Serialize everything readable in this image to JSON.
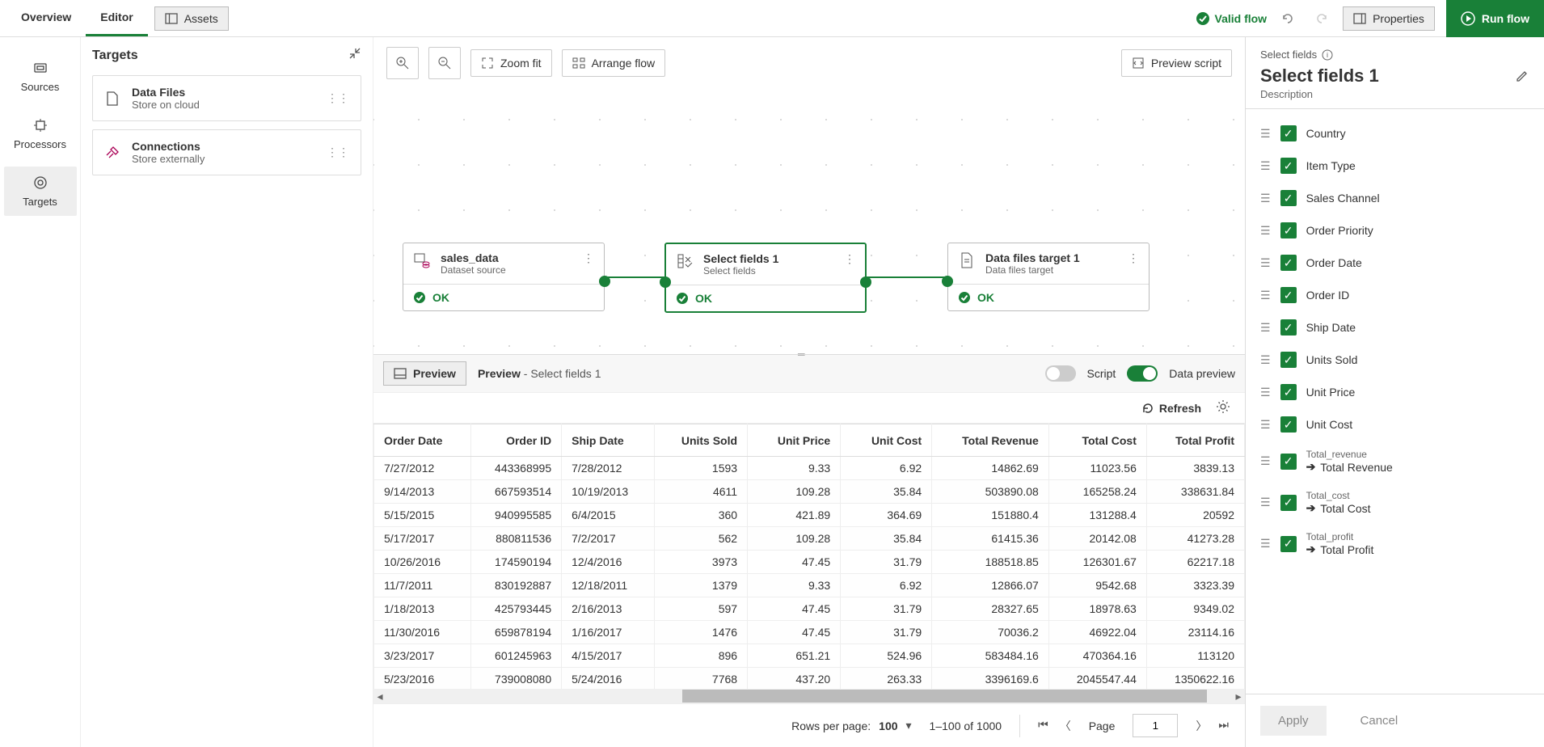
{
  "topbar": {
    "tabs": [
      "Overview",
      "Editor"
    ],
    "active_tab": "Editor",
    "assets_label": "Assets",
    "valid_flow": "Valid flow",
    "properties": "Properties",
    "run_flow": "Run flow"
  },
  "left_rail": {
    "items": [
      {
        "id": "sources",
        "label": "Sources"
      },
      {
        "id": "processors",
        "label": "Processors"
      },
      {
        "id": "targets",
        "label": "Targets"
      }
    ],
    "active": "targets"
  },
  "side_panel": {
    "title": "Targets",
    "cards": [
      {
        "title": "Data Files",
        "sub": "Store on cloud"
      },
      {
        "title": "Connections",
        "sub": "Store externally"
      }
    ]
  },
  "canvas": {
    "zoom_fit": "Zoom fit",
    "arrange_flow": "Arrange flow",
    "preview_script": "Preview script",
    "nodes": [
      {
        "title": "sales_data",
        "sub": "Dataset source",
        "status": "OK"
      },
      {
        "title": "Select fields 1",
        "sub": "Select fields",
        "status": "OK"
      },
      {
        "title": "Data files target 1",
        "sub": "Data files target",
        "status": "OK"
      }
    ]
  },
  "preview": {
    "btn": "Preview",
    "title": "Preview",
    "suffix": " - Select fields 1",
    "script": "Script",
    "data_preview": "Data preview",
    "refresh": "Refresh"
  },
  "table": {
    "columns": [
      "Order Date",
      "Order ID",
      "Ship Date",
      "Units Sold",
      "Unit Price",
      "Unit Cost",
      "Total Revenue",
      "Total Cost",
      "Total Profit"
    ],
    "rows": [
      [
        "7/27/2012",
        "443368995",
        "7/28/2012",
        "1593",
        "9.33",
        "6.92",
        "14862.69",
        "11023.56",
        "3839.13"
      ],
      [
        "9/14/2013",
        "667593514",
        "10/19/2013",
        "4611",
        "109.28",
        "35.84",
        "503890.08",
        "165258.24",
        "338631.84"
      ],
      [
        "5/15/2015",
        "940995585",
        "6/4/2015",
        "360",
        "421.89",
        "364.69",
        "151880.4",
        "131288.4",
        "20592"
      ],
      [
        "5/17/2017",
        "880811536",
        "7/2/2017",
        "562",
        "109.28",
        "35.84",
        "61415.36",
        "20142.08",
        "41273.28"
      ],
      [
        "10/26/2016",
        "174590194",
        "12/4/2016",
        "3973",
        "47.45",
        "31.79",
        "188518.85",
        "126301.67",
        "62217.18"
      ],
      [
        "11/7/2011",
        "830192887",
        "12/18/2011",
        "1379",
        "9.33",
        "6.92",
        "12866.07",
        "9542.68",
        "3323.39"
      ],
      [
        "1/18/2013",
        "425793445",
        "2/16/2013",
        "597",
        "47.45",
        "31.79",
        "28327.65",
        "18978.63",
        "9349.02"
      ],
      [
        "11/30/2016",
        "659878194",
        "1/16/2017",
        "1476",
        "47.45",
        "31.79",
        "70036.2",
        "46922.04",
        "23114.16"
      ],
      [
        "3/23/2017",
        "601245963",
        "4/15/2017",
        "896",
        "651.21",
        "524.96",
        "583484.16",
        "470364.16",
        "113120"
      ],
      [
        "5/23/2016",
        "739008080",
        "5/24/2016",
        "7768",
        "437.20",
        "263.33",
        "3396169.6",
        "2045547.44",
        "1350622.16"
      ]
    ]
  },
  "pager": {
    "rows_per_page_label": "Rows per page:",
    "rows_per_page": "100",
    "range": "1–100 of 1000",
    "page_label": "Page",
    "page": "1"
  },
  "right_panel": {
    "crumb": "Select fields",
    "title": "Select fields 1",
    "desc": "Description",
    "fields": [
      {
        "label": "Country"
      },
      {
        "label": "Item Type"
      },
      {
        "label": "Sales Channel"
      },
      {
        "label": "Order Priority"
      },
      {
        "label": "Order Date"
      },
      {
        "label": "Order ID"
      },
      {
        "label": "Ship Date"
      },
      {
        "label": "Units Sold"
      },
      {
        "label": "Unit Price"
      },
      {
        "label": "Unit Cost"
      },
      {
        "orig": "Total_revenue",
        "label": "Total Revenue"
      },
      {
        "orig": "Total_cost",
        "label": "Total Cost"
      },
      {
        "orig": "Total_profit",
        "label": "Total Profit"
      }
    ],
    "apply": "Apply",
    "cancel": "Cancel"
  }
}
